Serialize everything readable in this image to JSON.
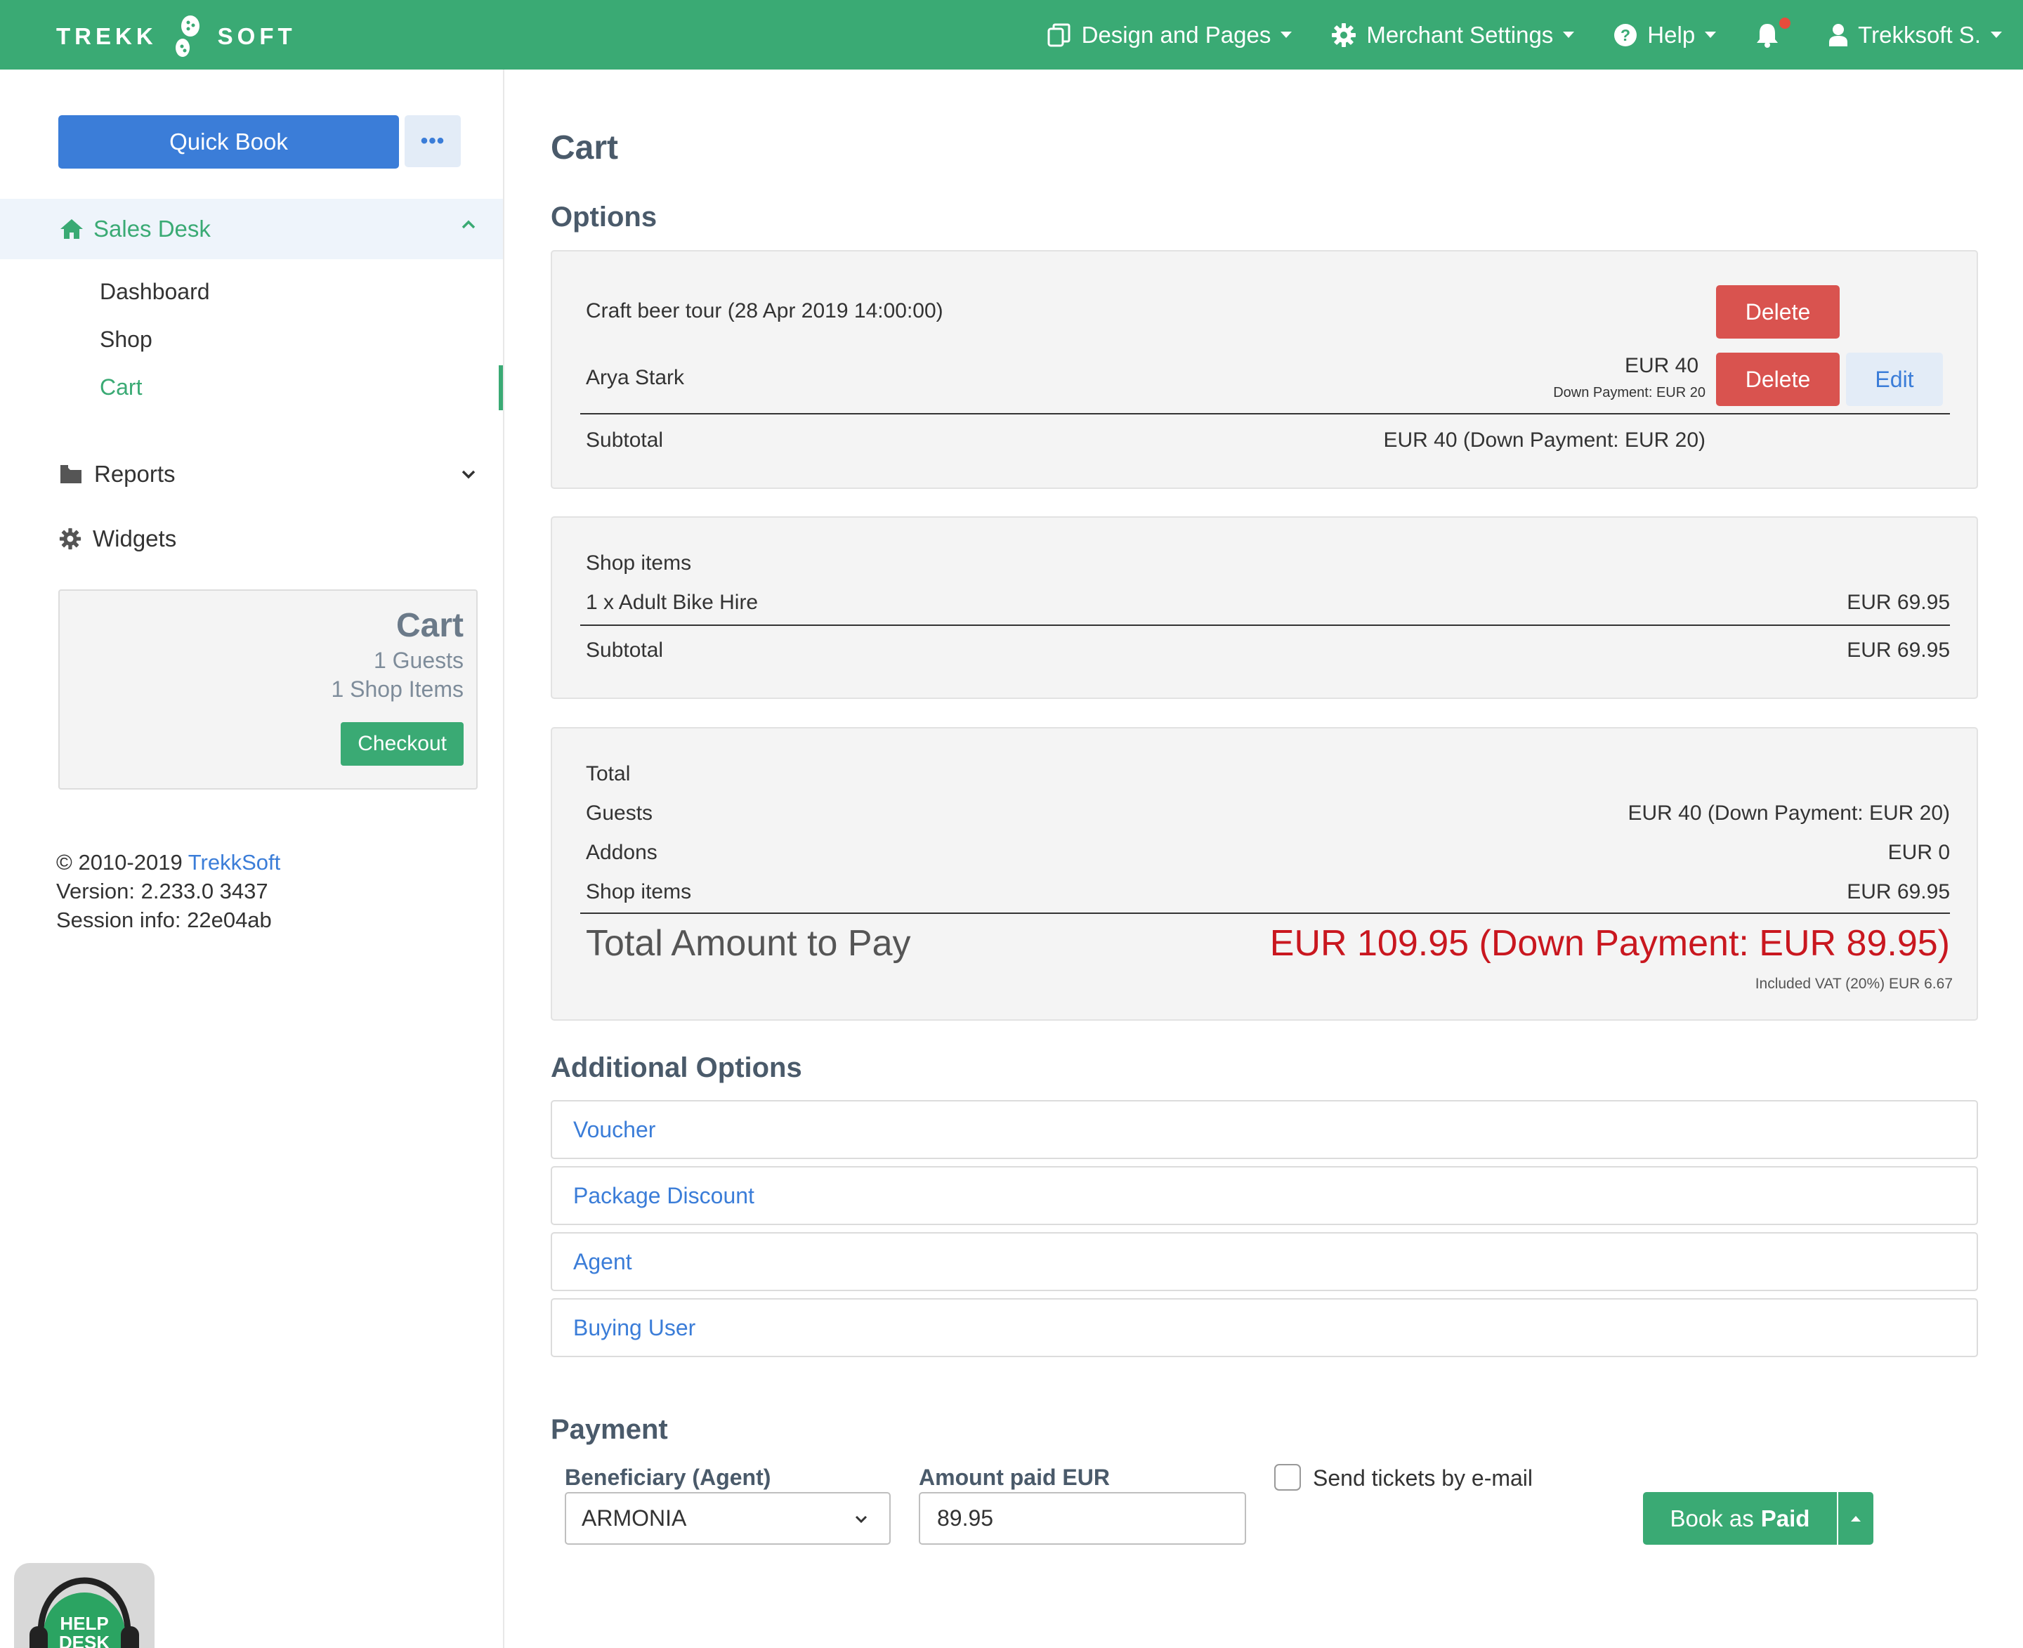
{
  "brand": {
    "left": "TREKK",
    "right": "SOFT"
  },
  "topnav": {
    "design": "Design and Pages",
    "merchant": "Merchant Settings",
    "help": "Help",
    "user": "Trekksoft S."
  },
  "sidebar": {
    "quick_book": "Quick Book",
    "more": "•••",
    "sales_desk": "Sales Desk",
    "sub_items": [
      "Dashboard",
      "Shop",
      "Cart"
    ],
    "reports": "Reports",
    "widgets": "Widgets",
    "cart_widget": {
      "title": "Cart",
      "guests": "1 Guests",
      "shop_items": "1 Shop Items",
      "checkout": "Checkout"
    },
    "footer": {
      "copyright": "© 2010-2019 ",
      "company": "TrekkSoft",
      "version": "Version: 2.233.0 3437",
      "session": "Session info: 22e04ab"
    },
    "helpdesk": [
      "HELP",
      "DESK"
    ]
  },
  "main": {
    "title": "Cart",
    "options_heading": "Options",
    "options": {
      "tour": "Craft beer tour (28 Apr 2019 14:00:00)",
      "delete": "Delete",
      "guest_name": "Arya Stark",
      "guest_price": "EUR 40",
      "guest_down": "Down Payment: EUR 20",
      "edit": "Edit",
      "subtotal_label": "Subtotal",
      "subtotal_value": "EUR 40 (Down Payment: EUR 20)"
    },
    "shop": {
      "heading": "Shop items",
      "item": "1 x Adult Bike Hire",
      "item_price": "EUR 69.95",
      "subtotal_label": "Subtotal",
      "subtotal_value": "EUR 69.95"
    },
    "totals": {
      "heading": "Total",
      "rows": [
        {
          "label": "Guests",
          "value": "EUR 40 (Down Payment: EUR 20)"
        },
        {
          "label": "Addons",
          "value": "EUR 0"
        },
        {
          "label": "Shop items",
          "value": "EUR 69.95"
        }
      ],
      "total_label": "Total Amount to Pay",
      "total_value": "EUR 109.95 (Down Payment: EUR 89.95)",
      "vat": "Included VAT (20%) EUR 6.67"
    },
    "additional_heading": "Additional Options",
    "additional": [
      "Voucher",
      "Package Discount",
      "Agent",
      "Buying User"
    ],
    "payment": {
      "heading": "Payment",
      "beneficiary_label": "Beneficiary (Agent)",
      "beneficiary_value": "ARMONIA",
      "amount_label": "Amount paid EUR",
      "amount_value": "89.95",
      "send_tickets": "Send tickets by e-mail",
      "book_prefix": "Book as",
      "book_strong": "Paid"
    }
  },
  "colors": {
    "brand_green": "#3aaa74",
    "primary_blue": "#3b7dd8",
    "danger_red": "#d9534f",
    "total_red": "#c9171f"
  }
}
